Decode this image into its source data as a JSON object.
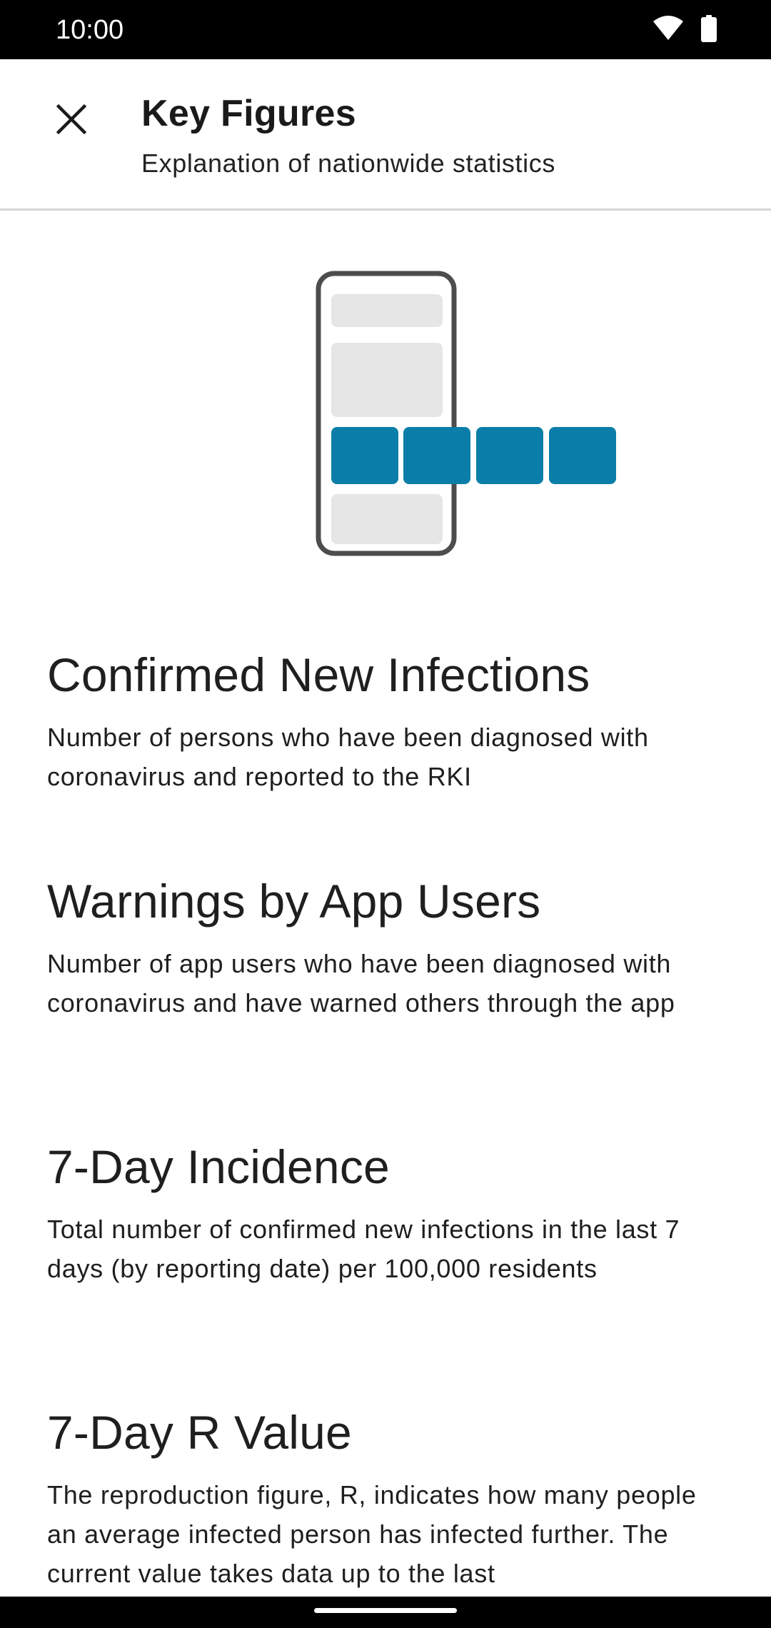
{
  "status_bar": {
    "time": "10:00",
    "icons": [
      "wifi-icon",
      "battery-icon"
    ]
  },
  "toolbar": {
    "close_icon": "close-icon",
    "title": "Key Figures",
    "subtitle": "Explanation of nationwide statistics"
  },
  "illustration": {
    "icon": "phone-key-figures-illustration",
    "colors": {
      "frame": "#4d4d4d",
      "placeholder": "#e6e6e6",
      "accent": "#0a7ea8"
    }
  },
  "sections": [
    {
      "heading": "Confirmed New Infections",
      "text": "Number of persons who have been diagnosed with coronavirus and reported to the RKI"
    },
    {
      "heading": "Warnings by App Users",
      "text": "Number of app users who have been diagnosed with coronavirus and have warned others through the app"
    },
    {
      "heading": "7-Day Incidence",
      "text": "Total number of confirmed new infections in the last 7 days (by reporting date) per 100,000 residents"
    },
    {
      "heading": "7-Day R Value",
      "text": "The reproduction figure, R, indicates how many people an average infected person has infected further. The current value takes data up to the last"
    }
  ]
}
